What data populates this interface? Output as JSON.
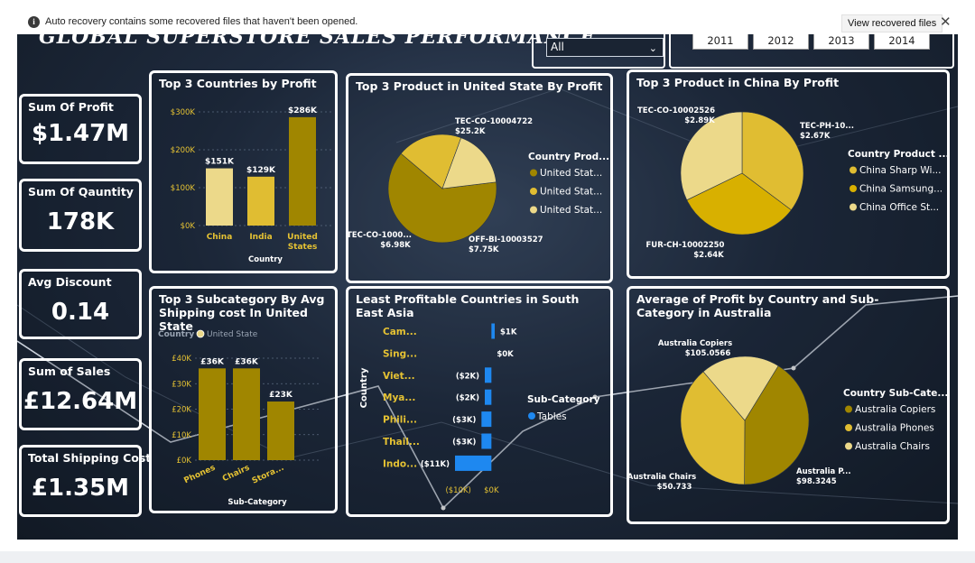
{
  "notification": {
    "message": "Auto recovery contains some recovered files that haven't been opened.",
    "button": "View recovered files",
    "info_icon": "i",
    "close_icon": "✕"
  },
  "page_title": "GLOBAL SUPERSTORE SALES PERFORMANCE",
  "slicer": {
    "value": "All",
    "icon": "chevron-down"
  },
  "years": [
    "2011",
    "2012",
    "2013",
    "2014"
  ],
  "kpis": [
    {
      "title": "Sum Of Profit",
      "value": "$1.47M"
    },
    {
      "title": "Sum Of Qauntity",
      "value": "178K"
    },
    {
      "title": "Avg Discount",
      "value": "0.14"
    },
    {
      "title": "Sum of Sales",
      "value": "£12.64M"
    },
    {
      "title": "Total Shipping Cost",
      "value": "£1.35M"
    }
  ],
  "colors": {
    "gold_dark": "#a08600",
    "gold_mid": "#e0bd32",
    "gold_light": "#ecd98a",
    "blue": "#1e88f0",
    "axis_label": "#e5c233"
  },
  "chart_data": [
    {
      "type": "bar",
      "title": "Top 3 Countries by Profit",
      "xlabel": "Country",
      "categories": [
        "China",
        "India",
        "United States"
      ],
      "category_lines": [
        [
          "China"
        ],
        [
          "India"
        ],
        [
          "United",
          "States"
        ]
      ],
      "values": [
        151,
        129,
        286
      ],
      "value_labels": [
        "$151K",
        "$129K",
        "$286K"
      ],
      "ylim": [
        0,
        300
      ],
      "yticks": [
        0,
        100,
        200,
        300
      ],
      "ytick_labels": [
        "$0K",
        "$100K",
        "$200K",
        "$300K"
      ],
      "colors": [
        "#ecd98a",
        "#e0bd32",
        "#a08600"
      ],
      "grid": true
    },
    {
      "type": "pie",
      "title": "Top 3 Product in United State By Profit",
      "legend_title": "Country Prod...",
      "legend": [
        "United Stat...",
        "United Stat...",
        "United Stat..."
      ],
      "slices": [
        {
          "label": "TEC-CO-10004722",
          "value": 25.2,
          "value_label": "$25.2K",
          "color": "#a08600"
        },
        {
          "label": "OFF-BI-10003527",
          "value": 7.75,
          "value_label": "$7.75K",
          "color": "#e0bd32"
        },
        {
          "label": "TEC-CO-1000...",
          "value": 6.98,
          "value_label": "$6.98K",
          "color": "#ecd98a"
        }
      ]
    },
    {
      "type": "pie",
      "title": "Top 3 Product in China By Profit",
      "legend_title": "Country Product ...",
      "legend": [
        "China Sharp Wi...",
        "China Samsung...",
        "China Office St..."
      ],
      "slices": [
        {
          "label": "TEC-CO-10002526",
          "value": 2.89,
          "value_label": "$2.89K",
          "color": "#e0bd32"
        },
        {
          "label": "TEC-PH-10...",
          "value": 2.67,
          "value_label": "$2.67K",
          "color": "#d8b000"
        },
        {
          "label": "FUR-CH-10002250",
          "value": 2.64,
          "value_label": "$2.64K",
          "color": "#ecd98a"
        }
      ]
    },
    {
      "type": "bar",
      "title": "Top 3 Subcategory By Avg Shipping cost In United State",
      "legend_title": "Country",
      "legend": [
        "United State"
      ],
      "xlabel": "Sub-Category",
      "categories": [
        "Phones",
        "Chairs",
        "Stora..."
      ],
      "values": [
        36,
        36,
        23
      ],
      "value_labels": [
        "£36K",
        "£36K",
        "£23K"
      ],
      "ylim": [
        0,
        40
      ],
      "yticks": [
        0,
        10,
        20,
        30,
        40
      ],
      "ytick_labels": [
        "£0K",
        "£10K",
        "£20K",
        "£30K",
        "£40K"
      ],
      "colors": [
        "#a08600",
        "#a08600",
        "#a08600"
      ],
      "grid": true
    },
    {
      "type": "bar",
      "orientation": "horizontal",
      "title": "Least Profitable Countries in South East Asia",
      "ylabel": "Country",
      "legend_title": "Sub-Category",
      "legend": [
        "Tables"
      ],
      "categories": [
        "Cam...",
        "Sing...",
        "Viet...",
        "Mya...",
        "Phili...",
        "Thail...",
        "Indo..."
      ],
      "values": [
        1,
        0,
        -2,
        -2,
        -3,
        -3,
        -11
      ],
      "value_labels": [
        "$1K",
        "$0K",
        "($2K)",
        "($2K)",
        "($3K)",
        "($3K)",
        "($11K)"
      ],
      "xlim": [
        -11,
        1
      ],
      "xticks": [
        -10,
        0
      ],
      "xtick_labels": [
        "($10K)",
        "$0K"
      ],
      "color": "#1e88f0"
    },
    {
      "type": "pie",
      "title": "Average of Profit by Country and Sub-Category in Australia",
      "legend_title": "Country Sub-Cate...",
      "legend": [
        "Australia Copiers",
        "Australia Phones",
        "Australia Chairs"
      ],
      "slices": [
        {
          "label": "Australia Copiers",
          "value": 105.0566,
          "value_label": "$105.0566",
          "color": "#a08600"
        },
        {
          "label": "Australia P...",
          "value": 98.3245,
          "value_label": "$98.3245",
          "color": "#e0bd32"
        },
        {
          "label": "Australia Chairs",
          "value": 50.733,
          "value_label": "$50.733",
          "color": "#ecd98a"
        }
      ]
    }
  ]
}
